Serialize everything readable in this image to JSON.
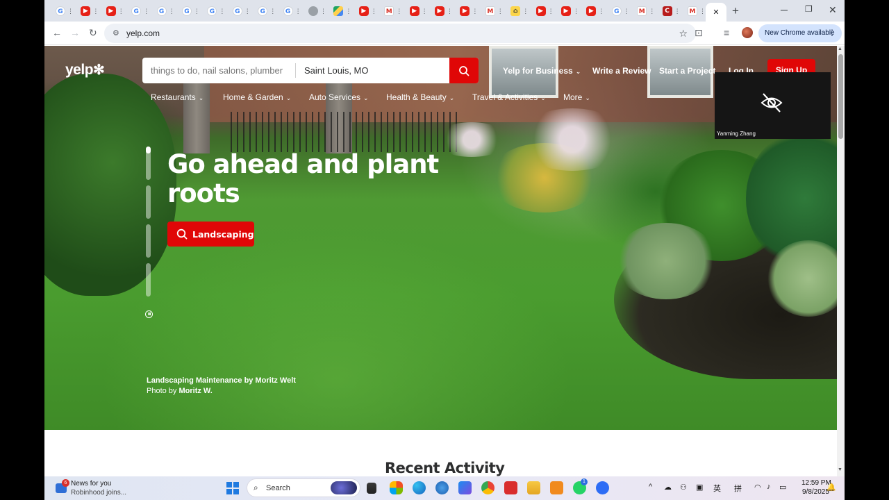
{
  "browser": {
    "tab_icons": [
      "g",
      "yt",
      "yt",
      "g",
      "g",
      "g",
      "g",
      "g",
      "g",
      "g",
      "apple",
      "drive",
      "yt",
      "m",
      "yt",
      "yt",
      "yt",
      "m",
      "house",
      "yt",
      "yt",
      "yt",
      "g",
      "m",
      "c",
      "m"
    ],
    "address": "yelp.com",
    "update_label": "New Chrome available"
  },
  "header": {
    "logo": "yelp",
    "search_find_placeholder": "things to do, nail salons, plumber",
    "search_near_value": "Saint Louis, MO",
    "nav": {
      "business": "Yelp for Business",
      "review": "Write a Review",
      "project": "Start a Project",
      "login": "Log In",
      "signup": "Sign Up"
    },
    "categories": [
      "Restaurants",
      "Home & Garden",
      "Auto Services",
      "Health & Beauty",
      "Travel & Activities",
      "More"
    ]
  },
  "hero": {
    "headline": "Go ahead and plant roots",
    "cta_label": "Landscaping",
    "credit_title": "Landscaping Maintenance by Moritz Welt",
    "credit_prefix": "Photo by",
    "credit_author": "Moritz W."
  },
  "video": {
    "participant": "Yanming Zhang"
  },
  "main": {
    "section_title": "Recent Activity"
  },
  "taskbar": {
    "news_title": "News for you",
    "news_subtitle": "Robinhood joins...",
    "news_badge": "6",
    "search_label": "Search",
    "whatsapp_badge": "1",
    "ime1": "英",
    "ime2": "拼",
    "time": "12:59 PM",
    "date": "9/8/2025"
  },
  "colors": {
    "yelp_red": "#e00707",
    "chrome_tabstrip": "#dfe3eb",
    "url_bar": "#eef1f6",
    "update_pill": "#d3e3fd"
  }
}
